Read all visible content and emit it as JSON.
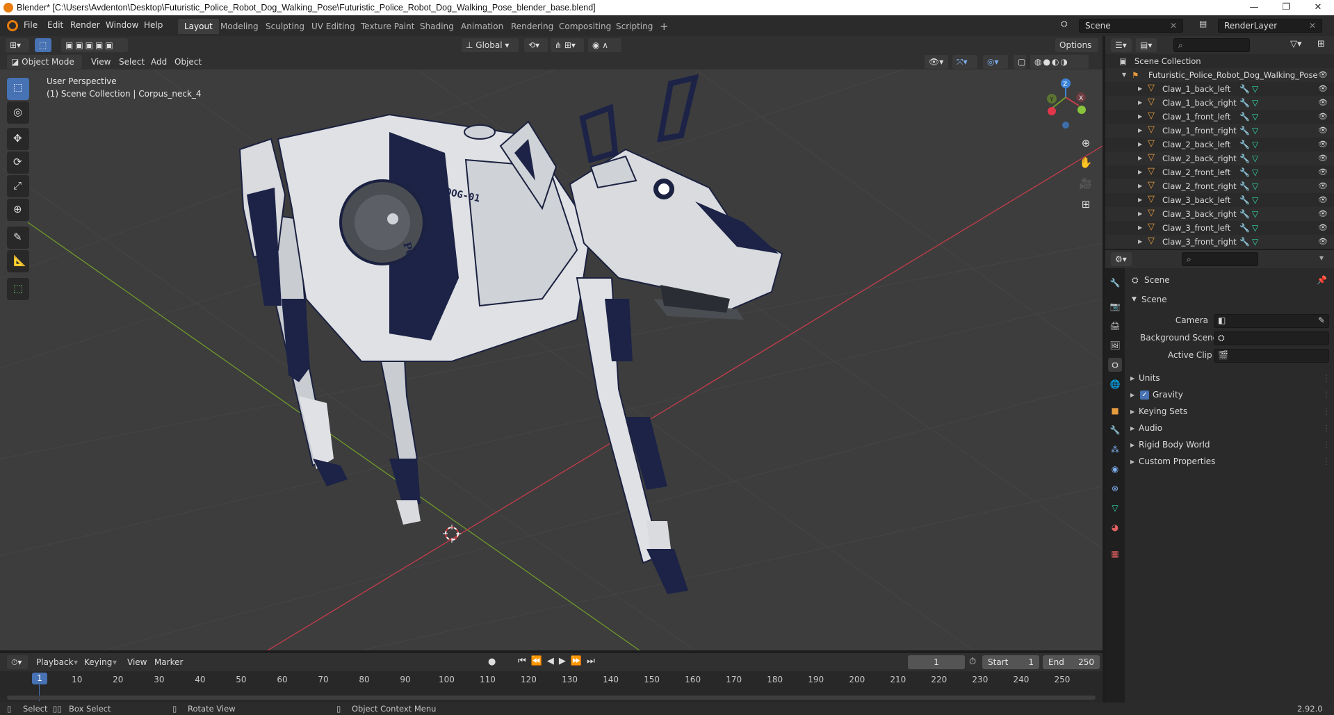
{
  "window": {
    "title": "Blender* [C:\\Users\\Avdenton\\Desktop\\Futuristic_Police_Robot_Dog_Walking_Pose\\Futuristic_Police_Robot_Dog_Walking_Pose_blender_base.blend]",
    "minimize": "—",
    "maximize": "❐",
    "close": "✕"
  },
  "menu": {
    "items": [
      "File",
      "Edit",
      "Render",
      "Window",
      "Help"
    ],
    "workspaces": [
      "Layout",
      "Modeling",
      "Sculpting",
      "UV Editing",
      "Texture Paint",
      "Shading",
      "Animation",
      "Rendering",
      "Compositing",
      "Scripting"
    ],
    "active_workspace": "Layout",
    "add_workspace": "+",
    "scene": "Scene",
    "view_layer": "RenderLayer"
  },
  "viewport_header": {
    "transform_orientation": "Global",
    "options": "Options",
    "mode": "Object Mode",
    "menus": [
      "View",
      "Select",
      "Add",
      "Object"
    ]
  },
  "viewport": {
    "perspective": "User Perspective",
    "collection_info": "(1) Scene Collection | Corpus_neck_4",
    "model_labels": [
      "DOG-01",
      "POLICE"
    ],
    "gizmo": {
      "x": "X",
      "y": "Y",
      "z": "Z"
    }
  },
  "timeline": {
    "menus": [
      "Playback",
      "Keying",
      "View",
      "Marker"
    ],
    "current_frame": "1",
    "start_label": "Start",
    "start": "1",
    "end_label": "End",
    "end": "250",
    "ruler": [
      "1",
      "10",
      "20",
      "30",
      "40",
      "50",
      "60",
      "70",
      "80",
      "90",
      "100",
      "110",
      "120",
      "130",
      "140",
      "150",
      "160",
      "170",
      "180",
      "190",
      "200",
      "210",
      "220",
      "230",
      "240",
      "250"
    ]
  },
  "statusbar": {
    "select": "Select",
    "box_select": "Box Select",
    "rotate_view": "Rotate View",
    "context_menu": "Object Context Menu",
    "version": "2.92.0"
  },
  "outliner": {
    "root": "Scene Collection",
    "collection": "Futuristic_Police_Robot_Dog_Walking_Pose",
    "objects": [
      "Claw_1_back_left",
      "Claw_1_back_right",
      "Claw_1_front_left",
      "Claw_1_front_right",
      "Claw_2_back_left",
      "Claw_2_back_right",
      "Claw_2_front_left",
      "Claw_2_front_right",
      "Claw_3_back_left",
      "Claw_3_back_right",
      "Claw_3_front_left",
      "Claw_3_front_right"
    ]
  },
  "properties": {
    "context": "Scene",
    "section": "Scene",
    "camera_label": "Camera",
    "background_scene_label": "Background Scene",
    "active_clip_label": "Active Clip",
    "panels": [
      "Units",
      "Gravity",
      "Keying Sets",
      "Audio",
      "Rigid Body World",
      "Custom Properties"
    ],
    "gravity_checked": true
  },
  "colors": {
    "accent": "#4772b3",
    "x_axis": "#c63c4a",
    "y_axis": "#6f9a2a",
    "z_axis": "#3d85d8"
  }
}
